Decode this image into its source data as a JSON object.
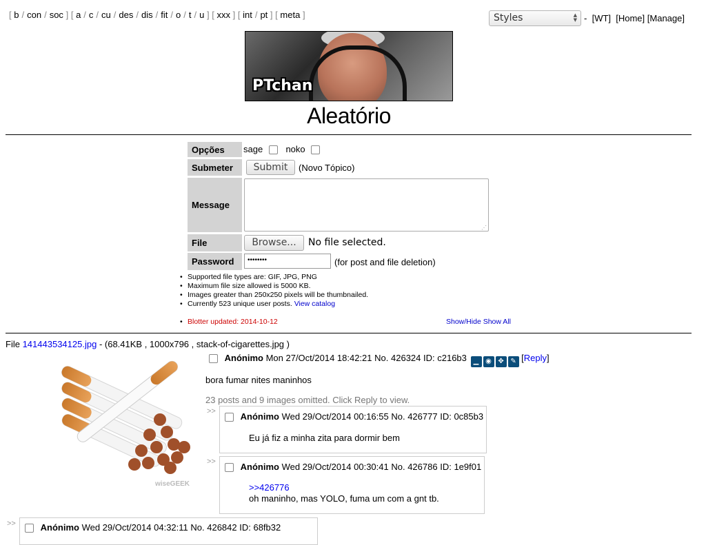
{
  "nav": {
    "groups": [
      [
        "b",
        "con",
        "soc"
      ],
      [
        "a",
        "c",
        "cu",
        "des",
        "dis",
        "fit",
        "o",
        "t",
        "u"
      ],
      [
        "xxx"
      ],
      [
        "int",
        "pt"
      ],
      [
        "meta"
      ]
    ]
  },
  "styles": {
    "selected": "Styles"
  },
  "toplinks": {
    "dash": "-",
    "wt": "[WT]",
    "home": "[Home]",
    "manage": "[Manage]"
  },
  "banner": {
    "logo_text": "PTchan"
  },
  "board": {
    "title": "Aleatório"
  },
  "form": {
    "options_label": "Opções",
    "sage_label": "sage",
    "noko_label": "noko",
    "submit_label": "Submeter",
    "submit_button": "Submit",
    "new_thread_note": "(Novo Tópico)",
    "message_label": "Message",
    "file_label": "File",
    "browse_button": "Browse...",
    "no_file": "No file selected.",
    "password_label": "Password",
    "password_value": "••••••••",
    "password_note": "(for post and file deletion)"
  },
  "rules": {
    "items": [
      "Supported file types are: GIF, JPG, PNG",
      "Maximum file size allowed is 5000 KB.",
      "Images greater than 250x250 pixels will be thumbnailed.",
      "Currently 523 unique user posts."
    ],
    "catalog_link": "View catalog"
  },
  "blotter": {
    "text": "Blotter updated: 2014-10-12",
    "show_hide": "Show/Hide",
    "show_all": "Show All"
  },
  "thread": {
    "file_prefix": "File",
    "file_link": "141443534125.jpg",
    "file_info": "- (68.41KB , 1000x796 , stack-of-cigarettes.jpg )",
    "watermark": "wiseGEEK",
    "op": {
      "name": "Anónimo",
      "date": "Mon 27/Oct/2014 18:42:21",
      "no": "No. 426324",
      "id": "ID: c216b3",
      "reply_link": "Reply",
      "message": "bora fumar nites maninhos"
    },
    "omitted": "23 posts and 9 images omitted. Click Reply to view.",
    "replies": [
      {
        "name": "Anónimo",
        "date": "Wed 29/Oct/2014 00:16:55",
        "no": "No. 426777",
        "id": "ID: 0c85b3",
        "quote": "",
        "message": "Eu já fiz a minha zita para dormir bem"
      },
      {
        "name": "Anónimo",
        "date": "Wed 29/Oct/2014 00:30:41",
        "no": "No. 426786",
        "id": "ID: 1e9f01",
        "quote": ">>426776",
        "message": "oh maninho, mas YOLO, fuma um com a gnt tb."
      },
      {
        "name": "Anónimo",
        "date": "Wed 29/Oct/2014 04:32:11",
        "no": "No. 426842",
        "id": "ID: 68fb32",
        "quote": "",
        "message": ""
      }
    ],
    "arrow": ">>"
  }
}
